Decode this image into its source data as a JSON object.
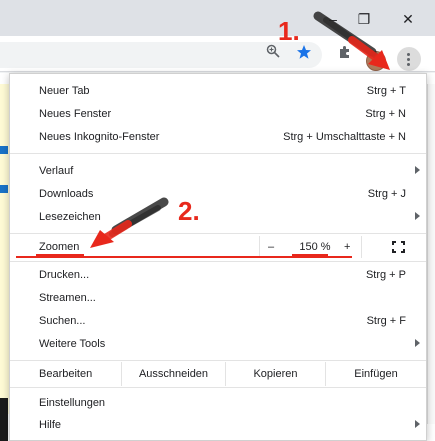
{
  "window": {
    "controls": [
      {
        "name": "minimize-icon",
        "glyph": "–"
      },
      {
        "name": "restore-icon",
        "glyph": "❐"
      },
      {
        "name": "close-icon",
        "glyph": "✕"
      }
    ]
  },
  "toolbar": {
    "zoom_icon": "zoom-magnifier-icon",
    "bookmark_star_icon": "bookmark-star-icon",
    "bookmark_star_color": "#1a73e8",
    "extensions_icon": "puzzle-icon",
    "profile_avatar": "avatar",
    "menu_icon": "three-dot-menu-icon"
  },
  "menu": {
    "group1": [
      {
        "label": "Neuer Tab",
        "shortcut": "Strg + T"
      },
      {
        "label": "Neues Fenster",
        "shortcut": "Strg + N"
      },
      {
        "label": "Neues Inkognito-Fenster",
        "shortcut": "Strg + Umschalttaste + N"
      }
    ],
    "group2": [
      {
        "label": "Verlauf",
        "shortcut": "",
        "submenu": true
      },
      {
        "label": "Downloads",
        "shortcut": "Strg + J",
        "submenu": false
      },
      {
        "label": "Lesezeichen",
        "shortcut": "",
        "submenu": true
      }
    ],
    "zoom": {
      "label": "Zoomen",
      "minus": "–",
      "value": "150 %",
      "plus": "+",
      "fullscreen_icon": "fullscreen-icon"
    },
    "group3": [
      {
        "label": "Drucken...",
        "shortcut": "Strg + P",
        "submenu": false
      },
      {
        "label": "Streamen...",
        "shortcut": "",
        "submenu": false
      },
      {
        "label": "Suchen...",
        "shortcut": "Strg + F",
        "submenu": false
      },
      {
        "label": "Weitere Tools",
        "shortcut": "",
        "submenu": true
      }
    ],
    "edit": {
      "label": "Bearbeiten",
      "cut": "Ausschneiden",
      "copy": "Kopieren",
      "paste": "Einfügen"
    },
    "group4": [
      {
        "label": "Einstellungen",
        "shortcut": "",
        "submenu": false
      },
      {
        "label": "Hilfe",
        "shortcut": "",
        "submenu": true
      }
    ]
  },
  "annotations": {
    "step1": "1.",
    "step2": "2.",
    "color": "#e8281c"
  }
}
